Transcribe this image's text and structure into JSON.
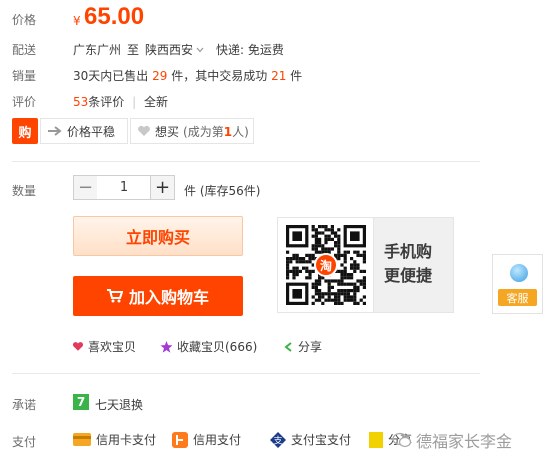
{
  "price": {
    "label": "价格",
    "currency": "¥",
    "value": "65.00"
  },
  "shipping": {
    "label": "配送",
    "from": "广东广州",
    "to_word": "至",
    "to": "陕西西安",
    "express": "快递: 免运费"
  },
  "sales": {
    "label": "销量",
    "prefix": "30天内已售出",
    "sold": "29",
    "unit1": "件，其中交易成功",
    "success": "21",
    "unit2": "件"
  },
  "reviews": {
    "label": "评价",
    "count": "53",
    "count_text": "条评价",
    "link": "全新"
  },
  "badges": {
    "logo_text": "购",
    "stable": "价格平稳",
    "want": "想买",
    "want_note_prefix": "(成为第",
    "want_rank": "1",
    "want_note_suffix": "人)"
  },
  "quantity": {
    "label": "数量",
    "value": "1",
    "unit": "件",
    "stock": "(库存56件)"
  },
  "buttons": {
    "buy_now": "立即购买",
    "add_cart": "加入购物车"
  },
  "qr": {
    "center_char": "淘",
    "line1": "手机购",
    "line2": "更便捷"
  },
  "service": {
    "label": "客服"
  },
  "actions": {
    "like": "喜欢宝贝",
    "collect": "收藏宝贝(666)",
    "share": "分享"
  },
  "promise": {
    "label": "承诺",
    "badge": "7",
    "text": "七天退换"
  },
  "payment": {
    "label": "支付",
    "methods": [
      "信用卡支付",
      "信用支付",
      "支付宝支付",
      "分享"
    ]
  },
  "watermark": "德福家长李金",
  "colors": {
    "accent": "#ff4400",
    "green": "#3ab449",
    "purple": "#a33ad6",
    "heart": "#e23a5b"
  }
}
